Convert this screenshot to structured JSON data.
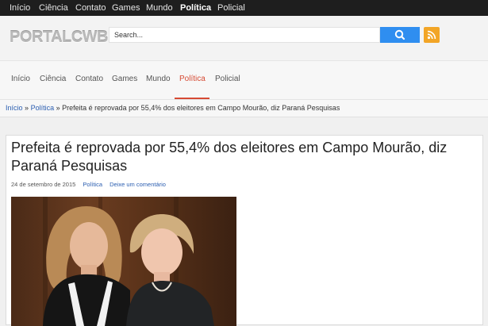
{
  "topnav": [
    "Início",
    "Ciência",
    "Contato",
    "Games",
    "Mundo",
    "Política",
    "Policial"
  ],
  "topnav_active": "Política",
  "logo": "PORTALCWB",
  "search": {
    "placeholder": "Search..."
  },
  "nav": [
    "Início",
    "Ciência",
    "Contato",
    "Games",
    "Mundo",
    "Política",
    "Policial"
  ],
  "nav_active": "Política",
  "breadcrumb": {
    "home": "Início",
    "sep": "»",
    "category": "Política",
    "current": "Prefeita é reprovada por 55,4% dos eleitores em Campo Mourão, diz Paraná Pesquisas"
  },
  "article": {
    "title": "Prefeita é reprovada por 55,4% dos eleitores em Campo Mourão, diz Paraná Pesquisas",
    "date": "24 de setembro de 2015",
    "category": "Política",
    "comment_link": "Deixe um comentário"
  },
  "colors": {
    "accent": "#d64a33",
    "link": "#2a5db0",
    "search_button": "#2f8ef0",
    "rss": "#f2a526",
    "topbar": "#1e1e1e"
  },
  "icons": {
    "search": "search-icon",
    "rss": "rss-icon"
  }
}
